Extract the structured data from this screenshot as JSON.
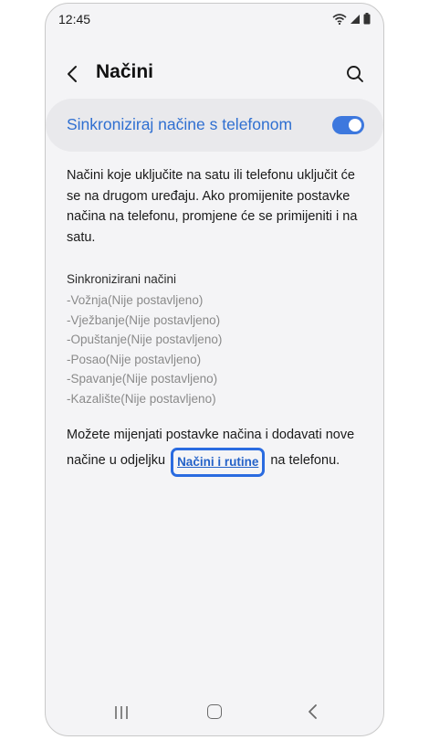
{
  "status": {
    "time": "12:45"
  },
  "header": {
    "title": "Načini"
  },
  "sync": {
    "label": "Sinkroniziraj načine s telefonom",
    "enabled": true
  },
  "description": "Načini koje uključite na satu ili telefonu uključit će se na drugom uređaju. Ako promijenite postavke načina na telefonu, promjene će se primijeniti i na satu.",
  "synced_modes": {
    "title": "Sinkronizirani načini",
    "items": [
      "-Vožnja(Nije postavljeno)",
      "-Vježbanje(Nije postavljeno)",
      "-Opuštanje(Nije postavljeno)",
      "-Posao(Nije postavljeno)",
      "-Spavanje(Nije postavljeno)",
      "-Kazalište(Nije postavljeno)"
    ]
  },
  "note": {
    "before": "Možete mijenjati postavke načina i dodavati nove načine u odjeljku ",
    "link": "Načini i rutine",
    "after": " na telefonu."
  },
  "colors": {
    "accent": "#2f6fd1",
    "highlight_border": "#2a6be0"
  }
}
